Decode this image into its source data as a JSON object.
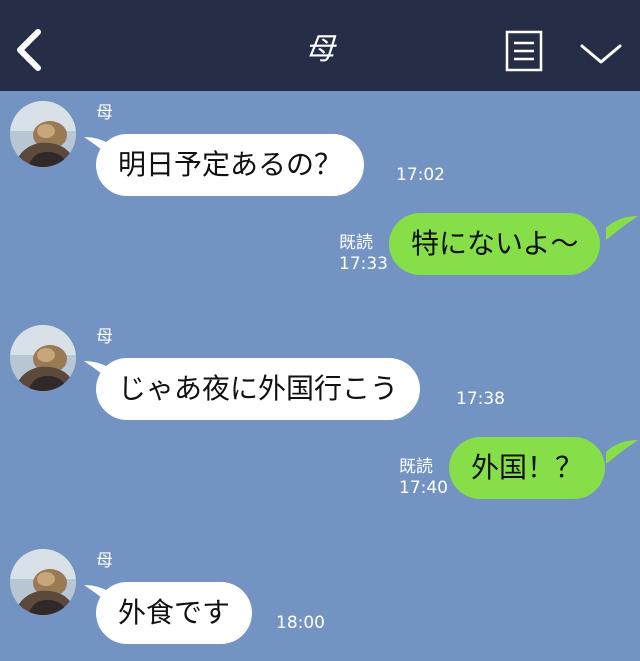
{
  "header": {
    "title": "母",
    "back_icon": "chevron-left-icon",
    "menu_icon": "menu-lines-icon",
    "dropdown_icon": "chevron-down-icon",
    "bg_color": "#252e46"
  },
  "chat": {
    "bg_color": "#7393c3",
    "incoming_bubble_color": "#ffffff",
    "outgoing_bubble_color": "#86df48",
    "messages": [
      {
        "direction": "in",
        "sender": "母",
        "text": "明日予定あるの？",
        "time": "17:02"
      },
      {
        "direction": "out",
        "read": "既読",
        "text": "特にないよ〜",
        "time": "17:33"
      },
      {
        "direction": "in",
        "sender": "母",
        "text": "じゃあ夜に外国行こう",
        "time": "17:38"
      },
      {
        "direction": "out",
        "read": "既読",
        "text": "外国！？",
        "time": "17:40"
      },
      {
        "direction": "in",
        "sender": "母",
        "text": "外食です",
        "time": "18:00"
      }
    ]
  }
}
